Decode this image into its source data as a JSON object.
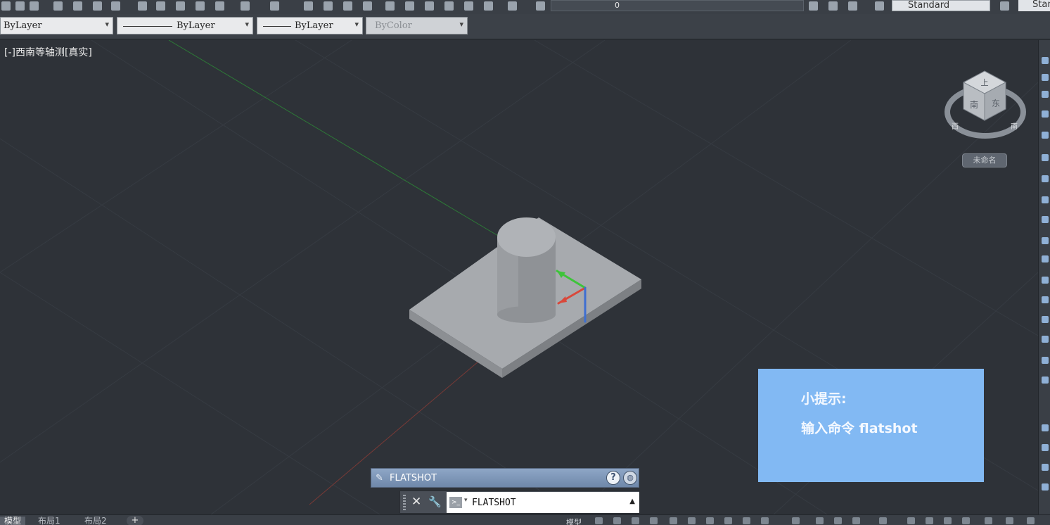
{
  "toolbar": {
    "layer_name": "0",
    "text_style": "Standard",
    "dim_style": "Stan"
  },
  "properties": {
    "color": "ByLayer",
    "linetype": "ByLayer",
    "lineweight": "ByLayer",
    "plot_style": "ByColor"
  },
  "viewport": {
    "label": "[-]西南等轴测[真实]",
    "viewcube_top": "上",
    "viewcube_front": "南",
    "viewcube_right": "东",
    "viewcube_west": "西",
    "viewcube_south": "南",
    "viewcube_ucs": "未命名"
  },
  "tip": {
    "title": "小提示:",
    "body": "输入命令 flatshot"
  },
  "command_dialog": {
    "title": "FLATSHOT",
    "input_value": "FLATSHOT"
  },
  "status_bar": {
    "tabs": [
      "模型",
      "布局1",
      "布局2"
    ],
    "model_label": "模型"
  },
  "colors": {
    "viewport_bg": "#2e3238",
    "tip_bg": "#82b9f3",
    "axis_x": "#d9483b",
    "axis_y": "#3ec43a",
    "axis_z": "#3e6fd1"
  }
}
